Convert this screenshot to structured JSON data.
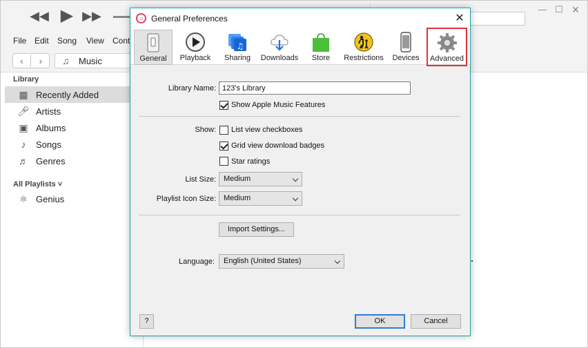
{
  "itunes": {
    "menu": [
      "File",
      "Edit",
      "Song",
      "View",
      "Cont"
    ],
    "media_picker": "Music",
    "sidebar": {
      "library_heading": "Library",
      "items": [
        {
          "label": "Recently Added",
          "icon": "grid-icon"
        },
        {
          "label": "Artists",
          "icon": "microphone-icon"
        },
        {
          "label": "Albums",
          "icon": "album-icon"
        },
        {
          "label": "Songs",
          "icon": "note-icon"
        },
        {
          "label": "Genres",
          "icon": "guitar-icon"
        }
      ],
      "playlists_heading": "All Playlists",
      "playlists_chevron": "˅",
      "playlists": [
        {
          "label": "Genius",
          "icon": "atom-icon"
        }
      ]
    }
  },
  "dialog": {
    "title": "General Preferences",
    "tabs": [
      {
        "label": "General",
        "icon": "switch-icon"
      },
      {
        "label": "Playback",
        "icon": "play-icon"
      },
      {
        "label": "Sharing",
        "icon": "sharing-icon"
      },
      {
        "label": "Downloads",
        "icon": "cloud-download-icon"
      },
      {
        "label": "Store",
        "icon": "shopping-bag-icon"
      },
      {
        "label": "Restrictions",
        "icon": "parental-icon"
      },
      {
        "label": "Devices",
        "icon": "phone-icon"
      },
      {
        "label": "Advanced",
        "icon": "gear-icon"
      }
    ],
    "library_name_label": "Library Name:",
    "library_name_value": "123's Library",
    "show_apple_music": "Show Apple Music Features",
    "show_label": "Show:",
    "show_options": [
      {
        "label": "List view checkboxes",
        "checked": false
      },
      {
        "label": "Grid view download badges",
        "checked": true
      },
      {
        "label": "Star ratings",
        "checked": false
      }
    ],
    "list_size_label": "List Size:",
    "list_size_value": "Medium",
    "playlist_icon_size_label": "Playlist Icon Size:",
    "playlist_icon_size_value": "Medium",
    "import_settings": "Import Settings...",
    "language_label": "Language:",
    "language_value": "English (United States)",
    "help": "?",
    "ok": "OK",
    "cancel": "Cancel"
  },
  "colors": {
    "dialog_border": "#1aa5a5",
    "highlight_box": "#e0303a",
    "ok_border": "#2f7bd4"
  }
}
